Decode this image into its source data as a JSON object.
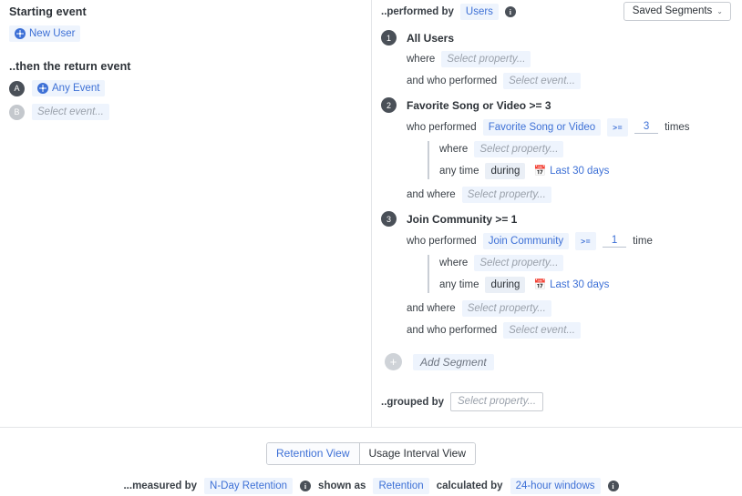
{
  "left": {
    "starting_event_label": "Starting event",
    "starting_event": {
      "name": "New User",
      "icon": "event-globe-icon"
    },
    "return_event_label": "..then the return event",
    "return_events": [
      {
        "badge": "A",
        "name": "Any Event",
        "icon": "event-globe-icon",
        "placeholder": false
      },
      {
        "badge": "B",
        "name": "Select event...",
        "placeholder": true
      }
    ]
  },
  "right": {
    "performed_by_label": "..performed by",
    "performed_by_value": "Users",
    "info_icon": "info-icon",
    "saved_segments_label": "Saved Segments",
    "caret_icon": "chevron-down-icon",
    "segments": [
      {
        "number": "1",
        "title": "All Users",
        "rows": [
          {
            "label": "where",
            "chips": [
              {
                "text": "Select property...",
                "type": "placeholder"
              }
            ]
          },
          {
            "label": "and who performed",
            "chips": [
              {
                "text": "Select event...",
                "type": "placeholder"
              }
            ]
          }
        ]
      },
      {
        "number": "2",
        "title": "Favorite Song or Video >= 3",
        "who_performed_label": "who performed",
        "event": "Favorite Song or Video",
        "operator": ">=",
        "count": "3",
        "count_unit": "times",
        "nested": [
          {
            "label": "where",
            "chips": [
              {
                "text": "Select property...",
                "type": "placeholder"
              }
            ]
          },
          {
            "label": "any time",
            "chips": [
              {
                "text": "during",
                "type": "plain"
              },
              {
                "text": "Last 30 days",
                "type": "date",
                "icon": "calendar-icon"
              }
            ]
          }
        ],
        "tail": [
          {
            "label": "and where",
            "chips": [
              {
                "text": "Select property...",
                "type": "placeholder"
              }
            ]
          }
        ]
      },
      {
        "number": "3",
        "title": "Join Community >= 1",
        "who_performed_label": "who performed",
        "event": "Join Community",
        "operator": ">=",
        "count": "1",
        "count_unit": "time",
        "nested": [
          {
            "label": "where",
            "chips": [
              {
                "text": "Select property...",
                "type": "placeholder"
              }
            ]
          },
          {
            "label": "any time",
            "chips": [
              {
                "text": "during",
                "type": "plain"
              },
              {
                "text": "Last 30 days",
                "type": "date",
                "icon": "calendar-icon"
              }
            ]
          }
        ],
        "tail": [
          {
            "label": "and where",
            "chips": [
              {
                "text": "Select property...",
                "type": "placeholder"
              }
            ]
          },
          {
            "label": "and who performed",
            "chips": [
              {
                "text": "Select event...",
                "type": "placeholder"
              }
            ]
          }
        ]
      }
    ],
    "add_segment_label": "Add Segment",
    "add_icon": "plus-icon",
    "grouped_by_label": "..grouped by",
    "grouped_by_placeholder": "Select property..."
  },
  "footer": {
    "views": [
      {
        "label": "Retention View",
        "active": true
      },
      {
        "label": "Usage Interval View",
        "active": false
      }
    ],
    "measured_by_label": "...measured by",
    "measured_by_value": "N-Day Retention",
    "shown_as_label": "shown as",
    "shown_as_value": "Retention",
    "calculated_by_label": "calculated by",
    "calculated_by_value": "24-hour windows"
  },
  "colors": {
    "accent": "#3d70d6",
    "chip_bg": "#eef4fd",
    "badge": "#4a5058",
    "border": "#e3e5e8"
  }
}
